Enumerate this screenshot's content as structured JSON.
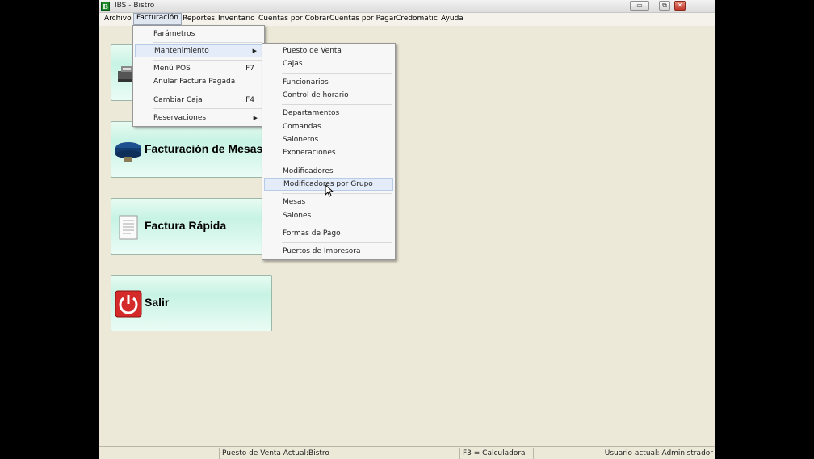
{
  "window": {
    "title": "IBS - Bistro",
    "icon": "app-b-icon",
    "icon_letter": "B"
  },
  "menubar": {
    "items": [
      "Archivo",
      "Facturación",
      "Reportes",
      "Inventario",
      "Cuentas por Cobrar",
      "Cuentas por Pagar",
      "Credomatic",
      "Ayuda"
    ]
  },
  "facturacion_menu": {
    "items": [
      {
        "label": "Parámetros"
      },
      {
        "label": "Mantenimiento"
      },
      {
        "label": "Menú POS",
        "shortcut": "F7"
      },
      {
        "label": "Anular Factura Pagada"
      },
      {
        "label": "Cambiar Caja",
        "shortcut": "F4"
      },
      {
        "label": "Reservaciones"
      }
    ]
  },
  "mantenimiento_menu": {
    "items": [
      "Puesto de Venta",
      "Cajas",
      "Funcionarios",
      "Control de horario",
      "Departamentos",
      "Comandas",
      "Saloneros",
      "Exoneraciones",
      "Modificadores",
      "Modificadores por Grupo",
      "Mesas",
      "Salones",
      "Formas de Pago",
      "Puertos de Impresora"
    ],
    "hovered": "Modificadores por Grupo"
  },
  "tiles": [
    {
      "label": "",
      "icon": "cash-register-icon"
    },
    {
      "label": "Facturación de Mesas",
      "icon": "table-icon"
    },
    {
      "label": "Factura Rápida",
      "icon": "document-icon"
    },
    {
      "label": "Salir",
      "icon": "power-icon"
    }
  ],
  "statusbar": {
    "puesto": "Puesto de Venta Actual:Bistro",
    "calculadora": "F3 = Calculadora",
    "usuario": "Usuario actual: Administrador"
  },
  "colors": {
    "tile_accent": "#c7f3e4",
    "menu_highlight": "#e3ecf8",
    "close_button": "#c0392b"
  }
}
